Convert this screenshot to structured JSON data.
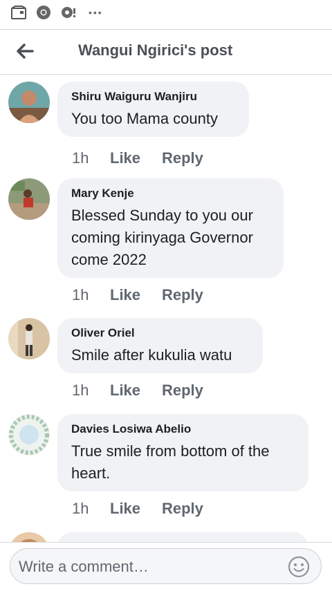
{
  "status_bar": {
    "icons": [
      "notification-tray-icon",
      "chrome-icon",
      "vpn-key-icon",
      "more-dots-icon"
    ],
    "more_label": "•••"
  },
  "header": {
    "title": "Wangui Ngirici's post",
    "back_icon": "back-arrow-icon"
  },
  "comments": [
    {
      "author": "Shiru Waiguru Wanjiru",
      "text": "You too Mama county",
      "time": "1h",
      "like": "Like",
      "reply": "Reply"
    },
    {
      "author": "Mary Kenje",
      "text": "Blessed Sunday to you our coming kirinyaga Governor come 2022",
      "time": "1h",
      "like": "Like",
      "reply": "Reply"
    },
    {
      "author": "Oliver Oriel",
      "text": "Smile after kukulia watu",
      "time": "1h",
      "like": "Like",
      "reply": "Reply"
    },
    {
      "author": "Davies Losiwa Abelio",
      "text": "True smile from bottom of the heart.",
      "time": "1h",
      "like": "Like",
      "reply": "Reply"
    }
  ],
  "composer": {
    "placeholder": "Write a comment…",
    "emoji_icon": "smiley-icon"
  },
  "colors": {
    "bubble": "#f0f2f5",
    "meta_text": "#606770",
    "title_text": "#4b4f56"
  }
}
